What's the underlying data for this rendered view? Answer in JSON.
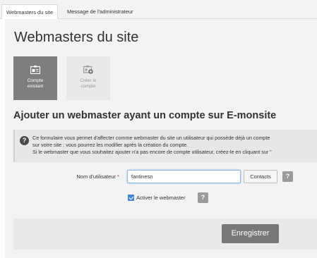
{
  "tabs": [
    {
      "label": "Webmasters du site",
      "active": true
    },
    {
      "label": "Message de l'administrateur",
      "active": false
    }
  ],
  "page_title": "Webmasters du site",
  "account_choices": [
    {
      "label_line1": "Compte",
      "label_line2": "existant",
      "icon": "id-card-icon",
      "selected": true
    },
    {
      "label_line1": "Créer le",
      "label_line2": "compte",
      "icon": "id-card-add-icon",
      "selected": false
    }
  ],
  "section_title": "Ajouter un webmaster ayant un compte sur E-monsite",
  "notice": {
    "line1": "Ce formulaire vous permet d'affecter comme webmaster du site un utilisateur qui possède déjà un compte",
    "line2": "sur votre site : vous pourrez les modifier après la création du compte.",
    "line3": "Si le webmaster que vous souhaitez ajouter n'a pas encore de compte utilisateur, créez-le en cliquant sur \""
  },
  "form": {
    "username_label": "Nom d'utilisateur",
    "required_mark": "*",
    "username_value": "fantinesn",
    "contacts_label": "Contacts",
    "help_label": "?",
    "activate_label": "Activer le webmaster",
    "activate_checked": true
  },
  "save_label": "Enregistrer",
  "colors": {
    "selected_tile": "#7e7e7e",
    "save_button": "#777777",
    "checkbox": "#3d8be0"
  }
}
